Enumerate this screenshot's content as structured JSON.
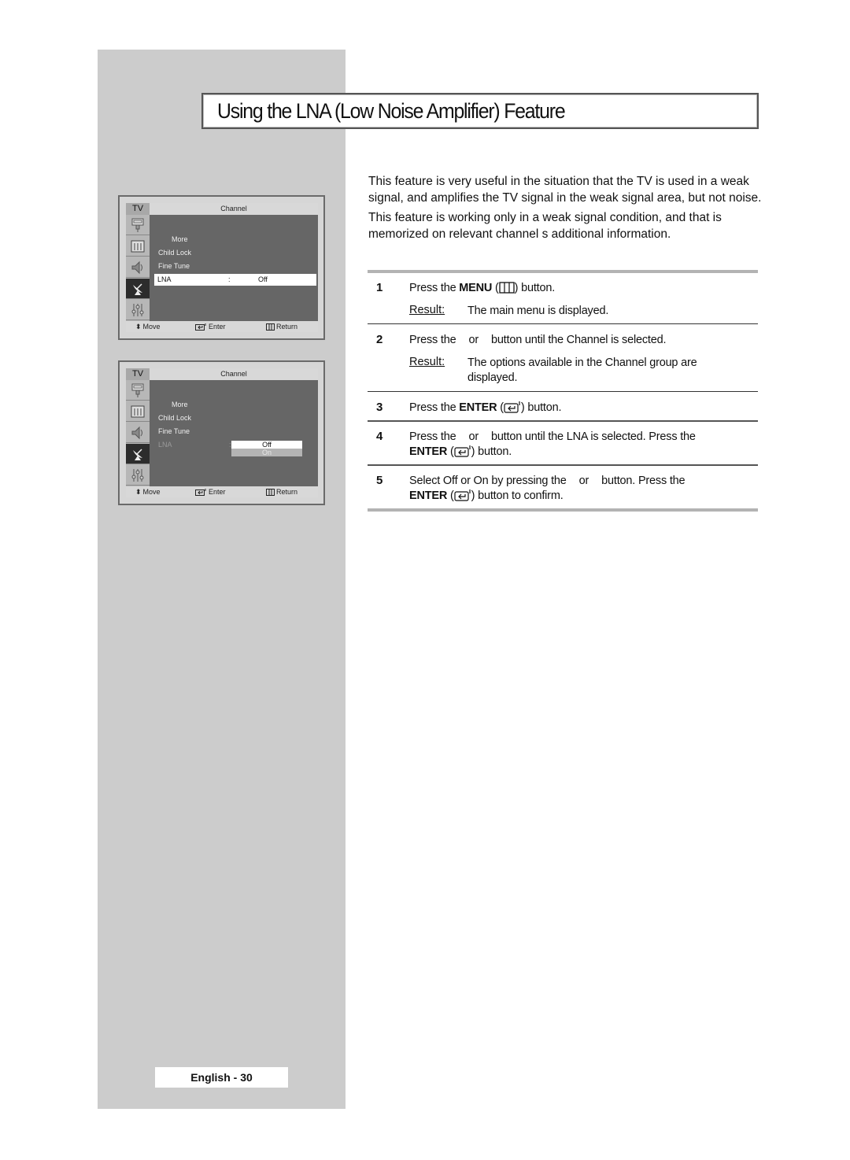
{
  "page": {
    "title": "Using the LNA (Low Noise Amplifier) Feature",
    "footer": "English - 30"
  },
  "intro": [
    "This feature is very useful in the situation that the TV is used in a weak signal, and amplifies the TV signal in the weak signal area, but not noise.",
    "This feature is working only in a weak signal condition, and that is memorized on relevant channel s additional information."
  ],
  "osd_screens": [
    {
      "tv_label": "TV",
      "menu_title": "Channel",
      "items": [
        "More",
        "Child Lock",
        "Fine Tune"
      ],
      "selected_item": {
        "label": "LNA",
        "separator": ":",
        "value": "Off"
      },
      "footer": {
        "move": "Move",
        "enter": "Enter",
        "return": "Return"
      }
    },
    {
      "tv_label": "TV",
      "menu_title": "Channel",
      "items": [
        "More",
        "Child Lock",
        "Fine Tune"
      ],
      "dim_item": {
        "label": "LNA",
        "separator": ":"
      },
      "dropdown": {
        "options": [
          "Off",
          "On"
        ],
        "highlighted": "Off"
      },
      "footer": {
        "move": "Move",
        "enter": "Enter",
        "return": "Return"
      }
    }
  ],
  "osd_icons": [
    "antenna-input-icon",
    "picture-icon",
    "sound-icon",
    "channel-satellite-icon",
    "setup-sliders-icon"
  ],
  "steps": [
    {
      "num": "1",
      "pre": "Press the ",
      "bold": "MENU",
      "icon": "menu-icon",
      "post": " button.",
      "result_label": "Result:",
      "result": "The main menu is displayed."
    },
    {
      "num": "2",
      "text_a": "Press the",
      "text_b": "or",
      "text_c": "button until the Channel   is selected.",
      "result_label": "Result:",
      "result": "The options available in the Channel   group are displayed."
    },
    {
      "num": "3",
      "pre": "Press the ",
      "bold": "ENTER",
      "icon": "enter-icon",
      "post": " button."
    },
    {
      "num": "4",
      "text_a": "Press the",
      "text_b": "or",
      "text_c": "button until the LNA is selected. Press the",
      "bold2": "ENTER",
      "post2": " button."
    },
    {
      "num": "5",
      "text_a": "Select Off   or On  by pressing the",
      "text_b": "or",
      "text_c": "button. Press the",
      "bold2": "ENTER",
      "post2": " button to confirm."
    }
  ]
}
